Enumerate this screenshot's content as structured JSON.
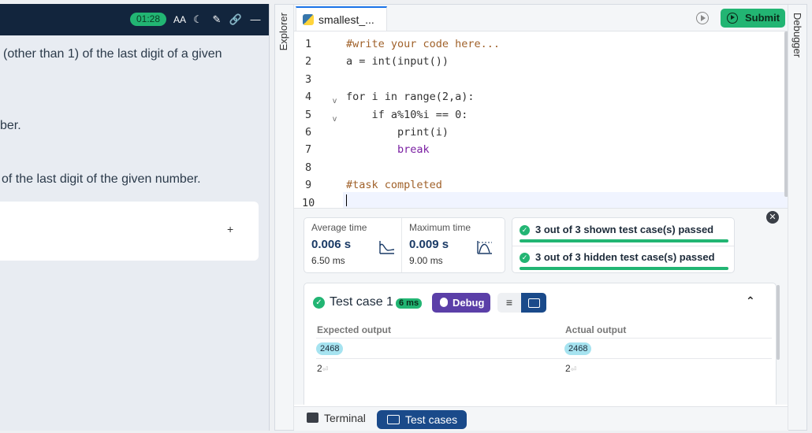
{
  "problem": {
    "timer": "01:28",
    "lines": [
      "(other than 1) of the last digit of a given",
      "ber.",
      "of the last digit of the given number."
    ],
    "input_add": "+"
  },
  "editor": {
    "file_tab": "smallest_...",
    "explorer_label": "Explorer",
    "debugger_label": "Debugger",
    "submit_label": "Submit",
    "line_numbers": [
      "1",
      "2",
      "3",
      "4",
      "5",
      "6",
      "7",
      "8",
      "9",
      "10"
    ],
    "code_lines": [
      "#write your code here...",
      "a = int(input())",
      "",
      "for i in range(2,a):",
      "    if a%10%i == 0:",
      "        print(i)",
      "        break",
      "",
      "#task completed",
      ""
    ]
  },
  "results": {
    "avg_time_label": "Average time",
    "avg_time_value": "0.006 s",
    "avg_time_sub": "6.50 ms",
    "max_time_label": "Maximum time",
    "max_time_value": "0.009 s",
    "max_time_sub": "9.00 ms",
    "shown_passed": "3 out of 3 shown test case(s) passed",
    "hidden_passed": "3 out of 3 hidden test case(s) passed",
    "test_case": {
      "title": "Test case 1",
      "time": "6 ms",
      "debug_label": "Debug",
      "expected_header": "Expected output",
      "actual_header": "Actual output",
      "expected_input": "2468",
      "actual_input": "2468",
      "expected_output": "2",
      "actual_output": "2"
    }
  },
  "bottom": {
    "terminal_label": "Terminal",
    "testcases_label": "Test cases"
  }
}
